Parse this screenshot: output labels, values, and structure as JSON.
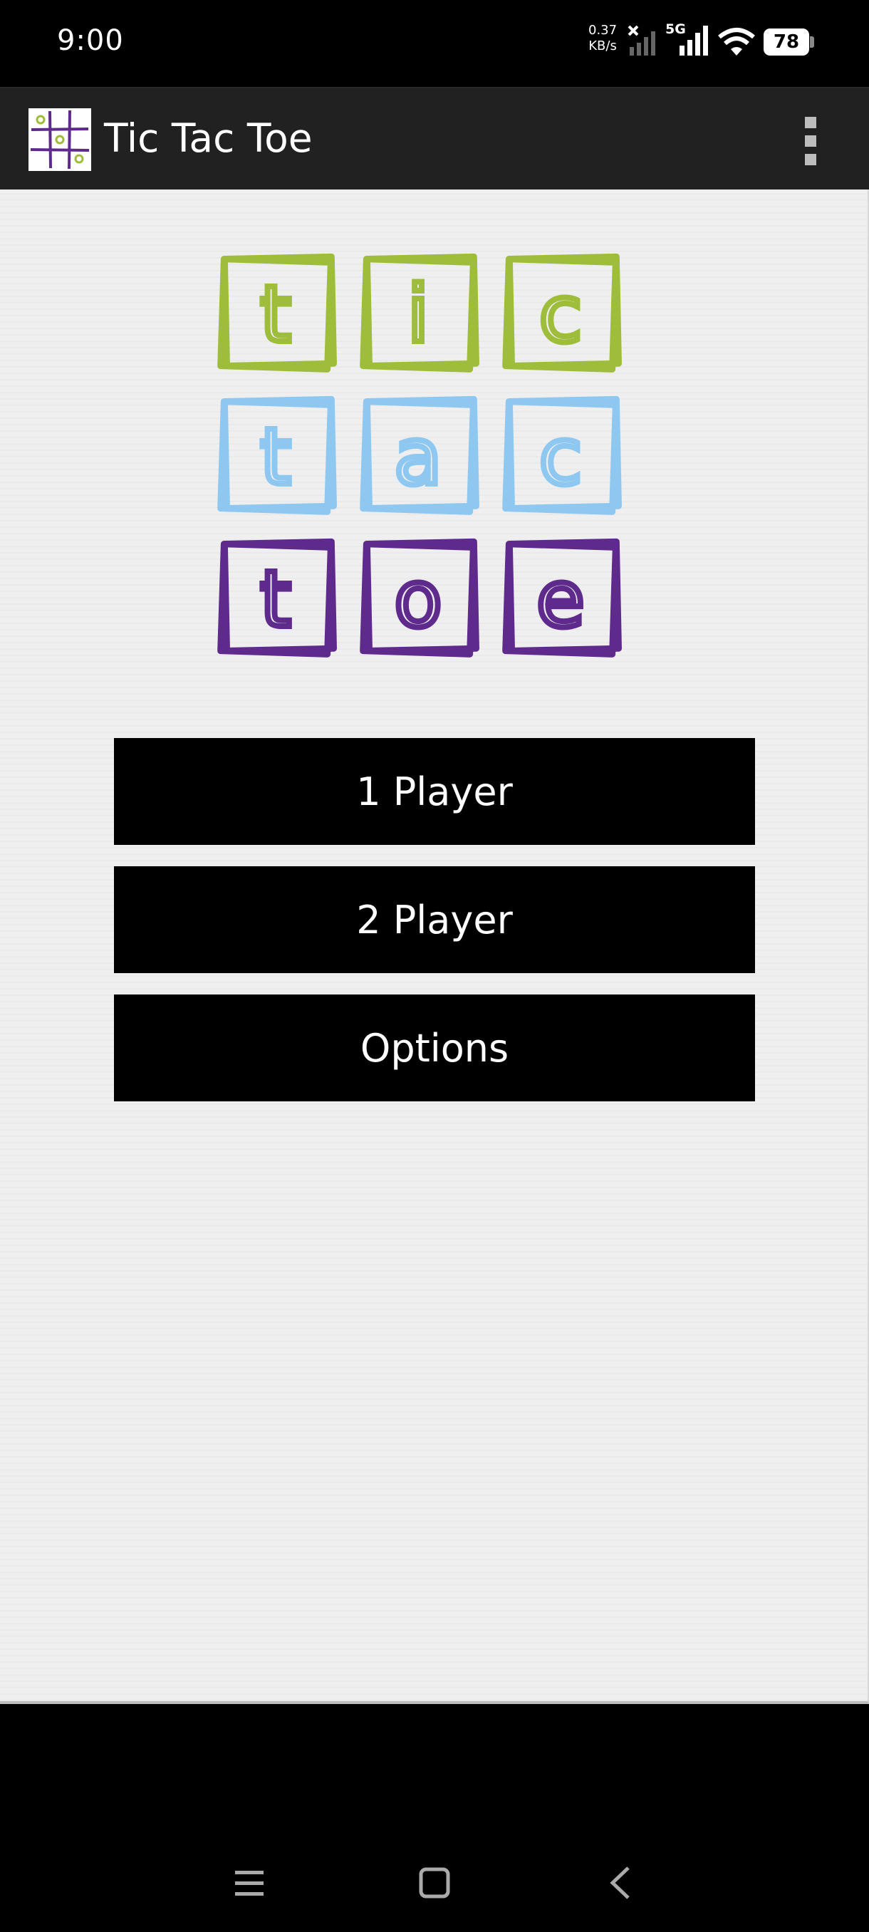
{
  "status_bar": {
    "time": "9:00",
    "net_speed_value": "0.37",
    "net_speed_unit": "KB/s",
    "network_type": "5G",
    "battery": "78",
    "icons": [
      "no-signal-sim1-icon",
      "signal-5g-icon",
      "wifi-icon",
      "battery-icon"
    ]
  },
  "app_bar": {
    "title": "Tic Tac Toe",
    "icon": "tic-tac-toe-app-icon",
    "menu_icon": "overflow-menu-icon"
  },
  "logo": {
    "rows": [
      {
        "color": "#9ebd3b",
        "letters": [
          "t",
          "i",
          "c"
        ]
      },
      {
        "color": "#8ec8f0",
        "letters": [
          "t",
          "a",
          "c"
        ]
      },
      {
        "color": "#5e2a8c",
        "letters": [
          "t",
          "o",
          "e"
        ]
      }
    ]
  },
  "menu": {
    "one_player": "1 Player",
    "two_player": "2 Player",
    "options": "Options"
  },
  "nav_bar": {
    "icons": [
      "recents-icon",
      "home-icon",
      "back-icon"
    ]
  }
}
